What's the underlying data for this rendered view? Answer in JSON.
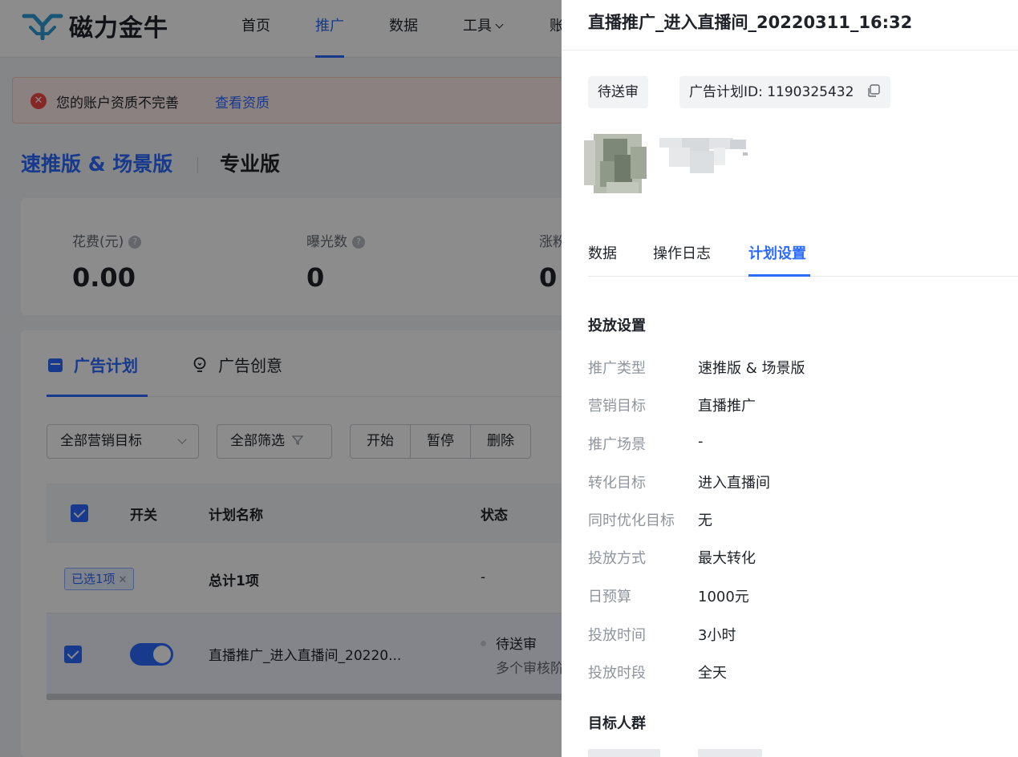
{
  "header": {
    "brand": "磁力金牛",
    "nav": [
      {
        "label": "首页",
        "active": false
      },
      {
        "label": "推广",
        "active": true
      },
      {
        "label": "数据",
        "active": false
      },
      {
        "label": "工具",
        "active": false
      },
      {
        "label": "账",
        "active": false
      }
    ]
  },
  "alert": {
    "message": "您的账户资质不完善",
    "link": "查看资质"
  },
  "versions": {
    "active": "速推版 & 场景版",
    "other": "专业版"
  },
  "stats": [
    {
      "label": "花费(元)",
      "value": "0.00"
    },
    {
      "label": "曝光数",
      "value": "0"
    },
    {
      "label": "涨粉",
      "value": "0"
    }
  ],
  "list": {
    "tabs": [
      {
        "label": "广告计划",
        "active": true
      },
      {
        "label": "广告创意",
        "active": false
      }
    ],
    "filters": {
      "goal_select": "全部营销目标",
      "filter_button": "全部筛选"
    },
    "actions": [
      "开始",
      "暂停",
      "删除"
    ],
    "columns": [
      "开关",
      "计划名称",
      "状态"
    ],
    "summary_row": {
      "chip": "已选1项",
      "name": "总计1项",
      "status": "-"
    },
    "rows": [
      {
        "name": "直播推广_进入直播间_20220...",
        "status": "待送审",
        "status_sub": "多个审核阶"
      }
    ]
  },
  "drawer": {
    "title": "直播推广_进入直播间_20220311_16:32",
    "status_tag": "待送审",
    "plan_id_label": "广告计划ID: 1190325432",
    "tabs": [
      {
        "label": "数据",
        "active": false
      },
      {
        "label": "操作日志",
        "active": false
      },
      {
        "label": "计划设置",
        "active": true
      }
    ],
    "section_delivery": "投放设置",
    "settings": [
      {
        "key": "推广类型",
        "value": "速推版 & 场景版"
      },
      {
        "key": "营销目标",
        "value": "直播推广"
      },
      {
        "key": "推广场景",
        "value": "-"
      },
      {
        "key": "转化目标",
        "value": "进入直播间"
      },
      {
        "key": "同时优化目标",
        "value": "无"
      },
      {
        "key": "投放方式",
        "value": "最大转化"
      },
      {
        "key": "日预算",
        "value": "1000元"
      },
      {
        "key": "投放时间",
        "value": "3小时"
      },
      {
        "key": "投放时段",
        "value": "全天"
      }
    ],
    "section_audience": "目标人群"
  },
  "colors": {
    "accent": "#2c6bff",
    "danger": "#f54a45",
    "overlay": "rgba(0,0,0,0.45)"
  },
  "icons": {
    "logo": "brand-logo-icon",
    "alert": "error-circle-icon",
    "help": "help-circle-icon",
    "plan_tab": "calendar-icon",
    "creative_tab": "lightbulb-icon",
    "filter": "funnel-icon",
    "copy": "copy-icon"
  }
}
